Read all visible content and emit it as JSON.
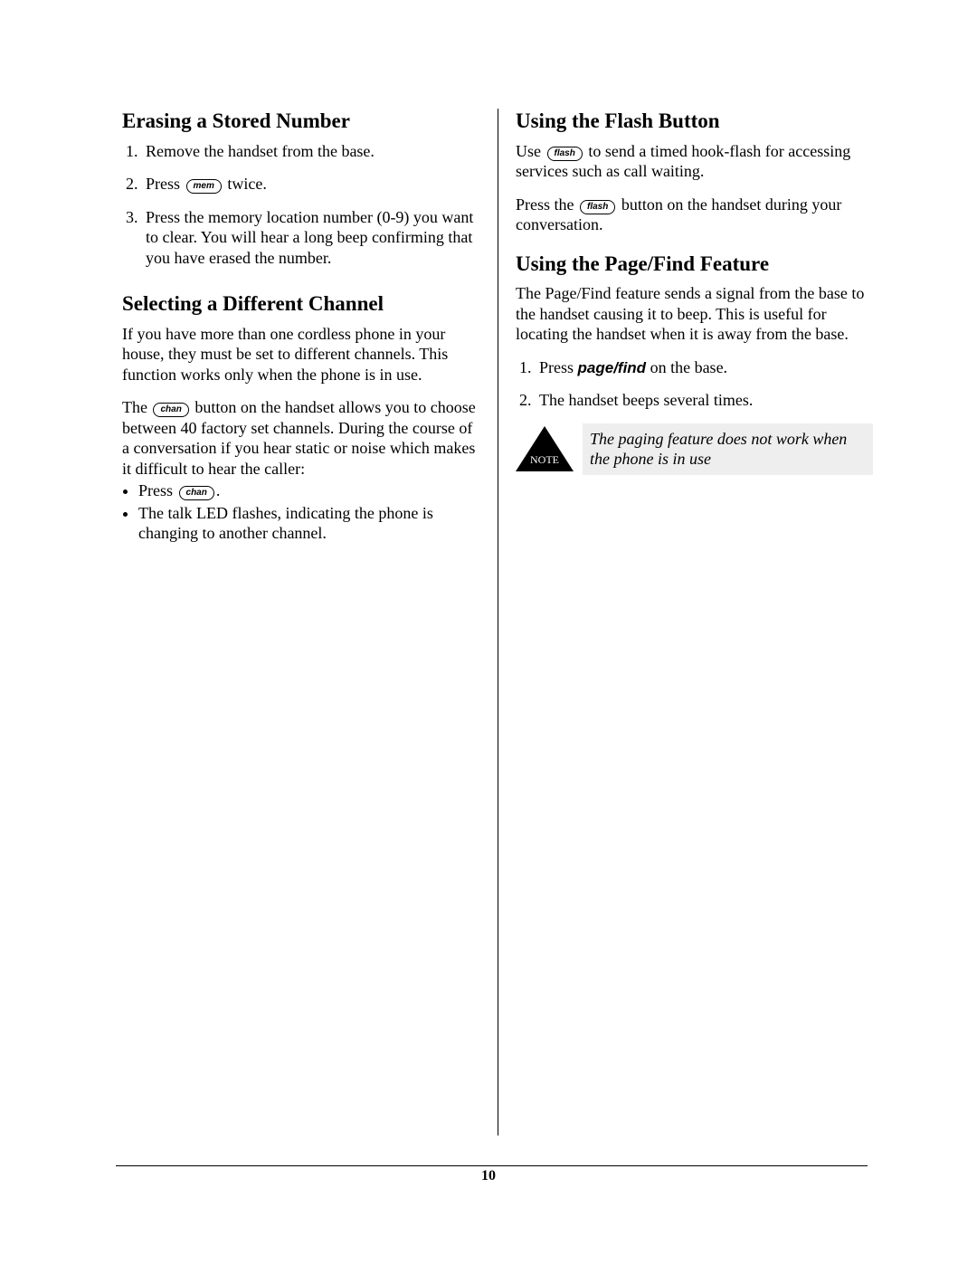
{
  "buttons": {
    "mem": "mem",
    "chan": "chan",
    "flash": "flash"
  },
  "left": {
    "h1": "Erasing a Stored Number",
    "l1": "Remove the handset from the base.",
    "l2a": "Press ",
    "l2b": " twice.",
    "l3": "Press the memory location number (0-9) you want to clear. You will hear a long beep confirming that you have erased the number.",
    "h2": "Selecting a Different Channel",
    "p1": "If you have more than one cordless phone in your house, they must be set to different channels. This function works only when the phone is in use.",
    "p2a": "The ",
    "p2b": " button on the handset allows you to choose between 40 factory set channels. During the course of a conversation if you hear static or noise which makes it difficult to hear the caller:",
    "b1a": "Press ",
    "b1b": ".",
    "b2": "The talk LED flashes, indicating the phone is changing to another channel."
  },
  "right": {
    "h1": "Using the Flash Button",
    "p1a": "Use ",
    "p1b": " to send a timed hook-flash for accessing services such as call waiting.",
    "p2a": "Press the ",
    "p2b": " button on the handset during your conversation.",
    "h2": "Using the Page/Find Feature",
    "p3": "The Page/Find feature sends a signal from the base to the handset causing it to beep. This is useful for locating the handset when it is away from the base.",
    "l1a": "Press ",
    "l1btn": "page/find",
    "l1b": " on the base.",
    "l2": "The handset beeps several times.",
    "noteLabel": "NOTE",
    "noteText": "The paging feature does not work when the phone is in use"
  },
  "pageNumber": "10"
}
